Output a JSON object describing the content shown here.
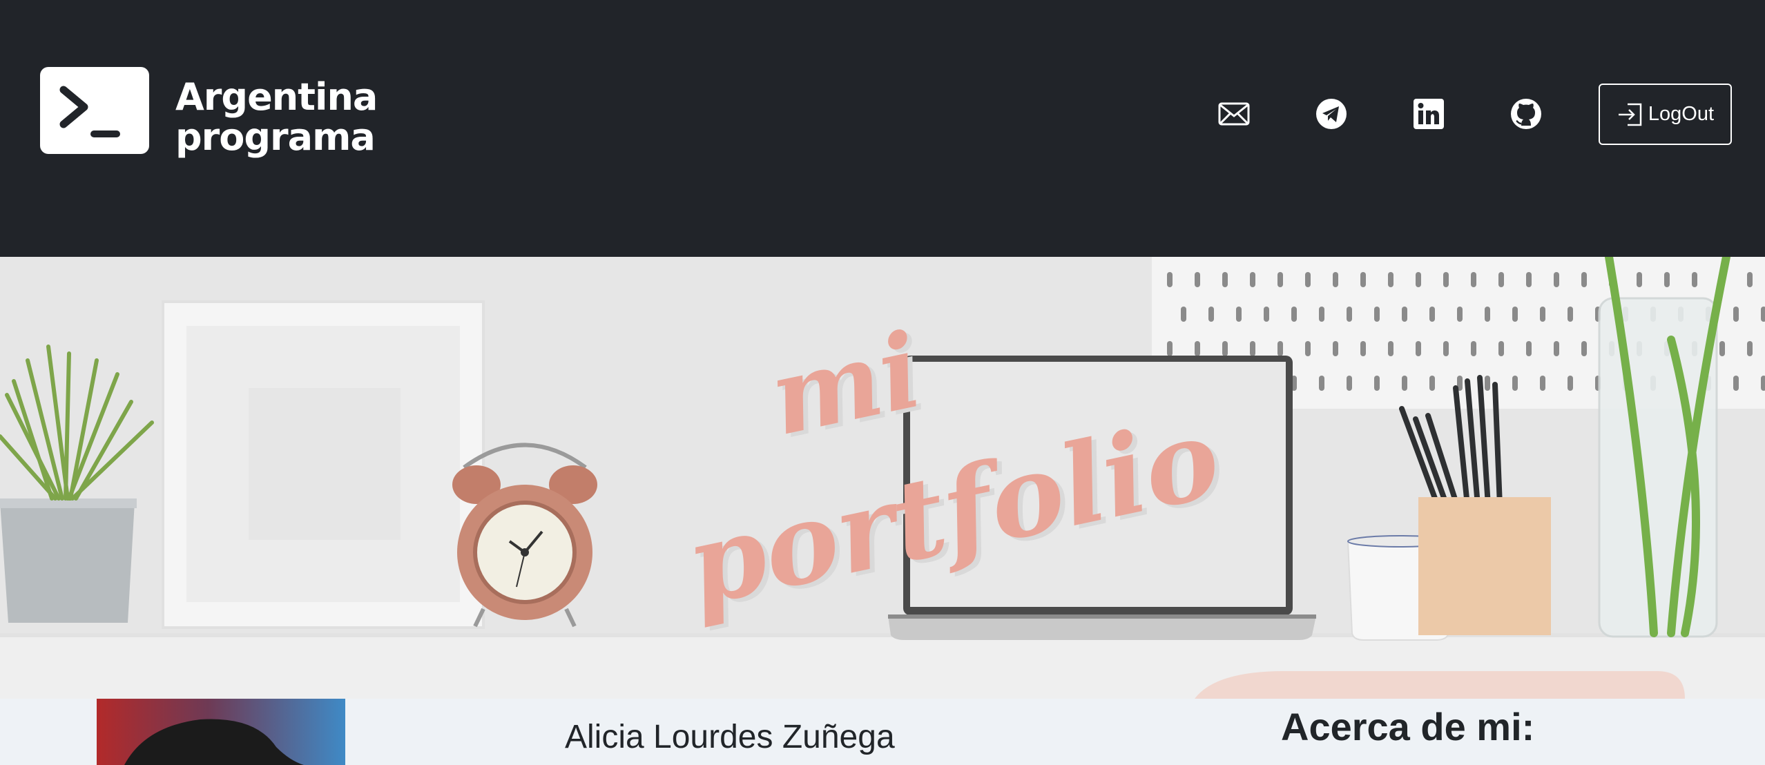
{
  "header": {
    "brand_line1": "Argentina",
    "brand_line2": "programa",
    "logo_icon": "terminal-prompt-icon",
    "social_icons": [
      "mail-icon",
      "telegram-icon",
      "linkedin-icon",
      "github-icon"
    ],
    "logout_label": "LogOut",
    "logout_icon": "login-arrow-icon"
  },
  "hero": {
    "overlay_line1": "mi",
    "overlay_line2": "portfolio",
    "overlay_color": "#e9a598"
  },
  "profile": {
    "name": "Alicia Lourdes Zuñega",
    "about_title": "Acerca de mi:"
  },
  "colors": {
    "navbar": "#212429",
    "text": "#212529",
    "strip": "#eef2f6"
  }
}
